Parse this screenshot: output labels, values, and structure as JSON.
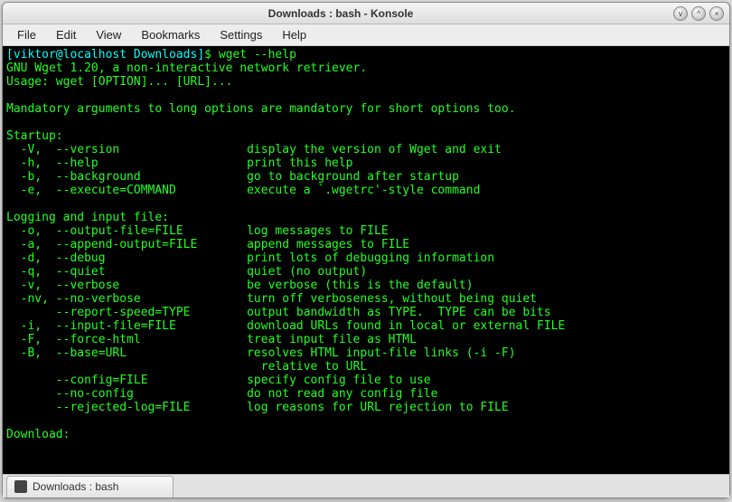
{
  "window": {
    "title": "Downloads : bash - Konsole"
  },
  "menu": {
    "items": [
      "File",
      "Edit",
      "View",
      "Bookmarks",
      "Settings",
      "Help"
    ]
  },
  "prompt": {
    "user_host": "[viktor@localhost Downloads]",
    "dollar": "$",
    "command": "wget --help"
  },
  "output": {
    "line_version": "GNU Wget 1.20, a non-interactive network retriever.",
    "line_usage": "Usage: wget [OPTION]... [URL]...",
    "line_mandatory": "Mandatory arguments to long options are mandatory for short options too.",
    "hdr_startup": "Startup:",
    "startup": [
      {
        "opt": "  -V,  --version",
        "desc": "display the version of Wget and exit"
      },
      {
        "opt": "  -h,  --help",
        "desc": "print this help"
      },
      {
        "opt": "  -b,  --background",
        "desc": "go to background after startup"
      },
      {
        "opt": "  -e,  --execute=COMMAND",
        "desc": "execute a `.wgetrc'-style command"
      }
    ],
    "hdr_logging": "Logging and input file:",
    "logging": [
      {
        "opt": "  -o,  --output-file=FILE",
        "desc": "log messages to FILE"
      },
      {
        "opt": "  -a,  --append-output=FILE",
        "desc": "append messages to FILE"
      },
      {
        "opt": "  -d,  --debug",
        "desc": "print lots of debugging information"
      },
      {
        "opt": "  -q,  --quiet",
        "desc": "quiet (no output)"
      },
      {
        "opt": "  -v,  --verbose",
        "desc": "be verbose (this is the default)"
      },
      {
        "opt": "  -nv, --no-verbose",
        "desc": "turn off verboseness, without being quiet"
      },
      {
        "opt": "       --report-speed=TYPE",
        "desc": "output bandwidth as TYPE.  TYPE can be bits"
      },
      {
        "opt": "  -i,  --input-file=FILE",
        "desc": "download URLs found in local or external FILE"
      },
      {
        "opt": "  -F,  --force-html",
        "desc": "treat input file as HTML"
      },
      {
        "opt": "  -B,  --base=URL",
        "desc": "resolves HTML input-file links (-i -F)"
      },
      {
        "opt": "",
        "desc": "  relative to URL"
      },
      {
        "opt": "       --config=FILE",
        "desc": "specify config file to use"
      },
      {
        "opt": "       --no-config",
        "desc": "do not read any config file"
      },
      {
        "opt": "       --rejected-log=FILE",
        "desc": "log reasons for URL rejection to FILE"
      }
    ],
    "hdr_download": "Download:"
  },
  "tab": {
    "label": "Downloads : bash"
  },
  "window_buttons": {
    "min": "v",
    "max": "^",
    "close": "×"
  }
}
